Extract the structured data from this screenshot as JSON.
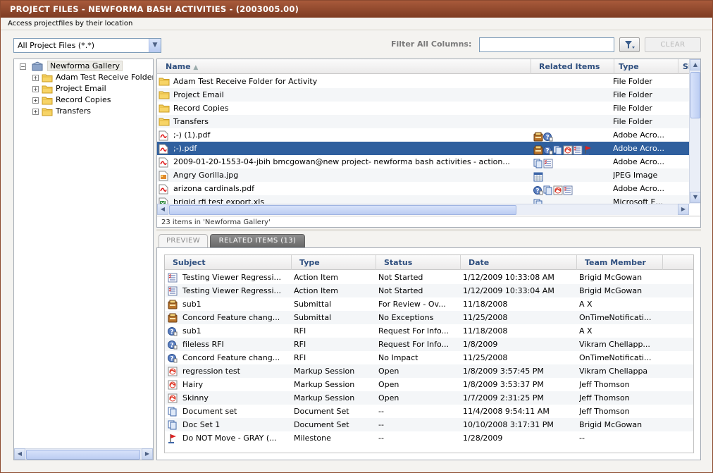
{
  "window": {
    "title": "PROJECT FILES - NEWFORMA BASH ACTIVITIES - (2003005.00)",
    "subtitle": "Access projectfiles by their location"
  },
  "toolbar": {
    "filter_select_value": "All Project Files (*.*)",
    "filter_label": "Filter All Columns:",
    "filter_value": "",
    "clear_label": "CLEAR"
  },
  "tree": {
    "root": "Newforma Gallery",
    "children": [
      "Adam Test Receive Folder for Activity",
      "Project Email",
      "Record Copies",
      "Transfers"
    ]
  },
  "files": {
    "columns": {
      "name": "Name",
      "related": "Related Items",
      "type": "Type",
      "size": "Si"
    },
    "rows": [
      {
        "name": "Adam Test Receive Folder for Activity",
        "type": "File Folder",
        "icon": "folder-icon",
        "related": []
      },
      {
        "name": "Project Email",
        "type": "File Folder",
        "icon": "folder-icon",
        "related": []
      },
      {
        "name": "Record Copies",
        "type": "File Folder",
        "icon": "folder-icon",
        "related": []
      },
      {
        "name": "Transfers",
        "type": "File Folder",
        "icon": "folder-icon",
        "related": []
      },
      {
        "name": ";-) (1).pdf",
        "type": "Adobe Acro...",
        "icon": "pdf-icon",
        "related": [
          "submittal-icon",
          "rfi-icon"
        ]
      },
      {
        "name": ";-).pdf",
        "type": "Adobe Acro...",
        "icon": "pdf-icon",
        "related": [
          "submittal-icon",
          "rfi-icon",
          "document-set-icon",
          "markup-icon",
          "action-item-icon",
          "milestone-icon"
        ]
      },
      {
        "name": "2009-01-20-1553-04-jbih bmcgowan@new project- newforma bash activities - action...",
        "type": "Adobe Acro...",
        "icon": "pdf-icon",
        "related": [
          "document-set-icon",
          "action-item-icon"
        ]
      },
      {
        "name": "Angry Gorilla.jpg",
        "type": "JPEG Image",
        "icon": "image-icon",
        "related": [
          "calendar-icon"
        ]
      },
      {
        "name": "arizona cardinals.pdf",
        "type": "Adobe Acro...",
        "icon": "pdf-icon",
        "related": [
          "rfi-icon",
          "document-set-icon",
          "markup-icon",
          "action-item-icon"
        ]
      },
      {
        "name": "brigid rfi test export.xls",
        "type": "Microsoft E...",
        "icon": "excel-icon",
        "related": [
          "document-set-icon"
        ]
      }
    ],
    "selected_index": 5,
    "status": "23 items in 'Newforma Gallery'"
  },
  "tabs": [
    {
      "label": "PREVIEW",
      "active": false
    },
    {
      "label": "RELATED ITEMS (13)",
      "active": true
    }
  ],
  "related": {
    "columns": {
      "subject": "Subject",
      "type": "Type",
      "status": "Status",
      "date": "Date",
      "member": "Team Member"
    },
    "rows": [
      {
        "icon": "action-item-icon",
        "subject": "Testing Viewer Regressi...",
        "type": "Action Item",
        "status": "Not Started",
        "date": "1/12/2009 10:33:08 AM",
        "member": "Brigid McGowan"
      },
      {
        "icon": "action-item-icon",
        "subject": "Testing Viewer Regressi...",
        "type": "Action Item",
        "status": "Not Started",
        "date": "1/12/2009 10:33:04 AM",
        "member": "Brigid McGowan"
      },
      {
        "icon": "submittal-icon",
        "subject": "sub1",
        "type": "Submittal",
        "status": "For Review - Ov...",
        "date": "11/18/2008",
        "member": "A X"
      },
      {
        "icon": "submittal-icon",
        "subject": "Concord Feature chang...",
        "type": "Submittal",
        "status": "No Exceptions",
        "date": "11/25/2008",
        "member": "OnTimeNotificati..."
      },
      {
        "icon": "rfi-icon",
        "subject": "sub1",
        "type": "RFI",
        "status": "Request For Info...",
        "date": "11/18/2008",
        "member": "A X"
      },
      {
        "icon": "rfi-icon",
        "subject": "fileless RFI",
        "type": "RFI",
        "status": "Request For Info...",
        "date": "1/8/2009",
        "member": "Vikram Chellapp..."
      },
      {
        "icon": "rfi-icon",
        "subject": "Concord Feature chang...",
        "type": "RFI",
        "status": "No Impact",
        "date": "11/25/2008",
        "member": "OnTimeNotificati..."
      },
      {
        "icon": "markup-icon",
        "subject": "regression test",
        "type": "Markup Session",
        "status": "Open",
        "date": "1/8/2009 3:57:45 PM",
        "member": "Vikram Chellappa"
      },
      {
        "icon": "markup-icon",
        "subject": "Hairy",
        "type": "Markup Session",
        "status": "Open",
        "date": "1/8/2009 3:53:37 PM",
        "member": "Jeff Thomson"
      },
      {
        "icon": "markup-icon",
        "subject": "Skinny",
        "type": "Markup Session",
        "status": "Open",
        "date": "1/7/2009 2:31:25 PM",
        "member": "Jeff Thomson"
      },
      {
        "icon": "document-set-icon",
        "subject": "Document set",
        "type": "Document Set",
        "status": "--",
        "date": "11/4/2008 9:54:11 AM",
        "member": "Jeff Thomson"
      },
      {
        "icon": "document-set-icon",
        "subject": "Doc Set 1",
        "type": "Document Set",
        "status": "--",
        "date": "10/10/2008 3:17:31 PM",
        "member": "Brigid McGowan"
      },
      {
        "icon": "milestone-icon",
        "subject": "Do NOT Move - GRAY (...",
        "type": "Milestone",
        "status": "--",
        "date": "1/28/2009",
        "member": "--"
      }
    ]
  },
  "colors": {
    "titlebar": "#8c4a2f",
    "selection": "#2f5f9e",
    "header_text": "#2f4f7f"
  }
}
